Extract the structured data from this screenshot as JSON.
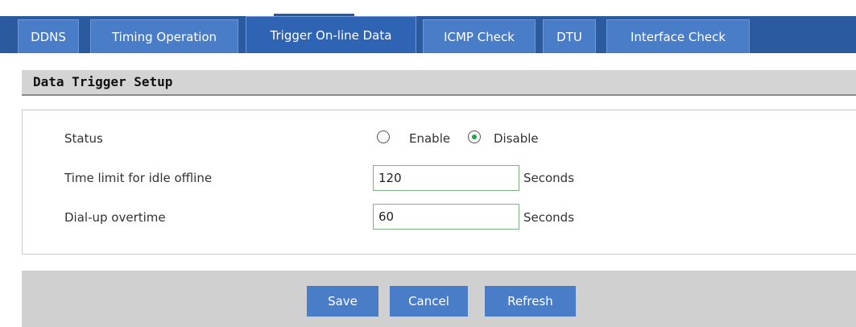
{
  "tabs": [
    {
      "label": "DDNS",
      "active": false
    },
    {
      "label": "Timing Operation",
      "active": false
    },
    {
      "label": "Trigger On-line Data",
      "active": true
    },
    {
      "label": "ICMP Check",
      "active": false
    },
    {
      "label": "DTU",
      "active": false
    },
    {
      "label": "Interface Check",
      "active": false
    }
  ],
  "section": {
    "title": "Data Trigger Setup"
  },
  "form": {
    "status_label": "Status",
    "status_options": {
      "enable": "Enable",
      "disable": "Disable",
      "selected": "Disable"
    },
    "idle_label": "Time limit for idle offline",
    "idle_value": "120",
    "idle_unit": "Seconds",
    "dial_label": "Dial-up overtime",
    "dial_value": "60",
    "dial_unit": "Seconds"
  },
  "buttons": {
    "save": "Save",
    "cancel": "Cancel",
    "refresh": "Refresh"
  },
  "colors": {
    "tab_bar": "#2c5a9e",
    "tab": "#4a7dc8",
    "button": "#4a7dc8",
    "footer": "#d0d0d0",
    "section_header": "#d4d4d4"
  }
}
